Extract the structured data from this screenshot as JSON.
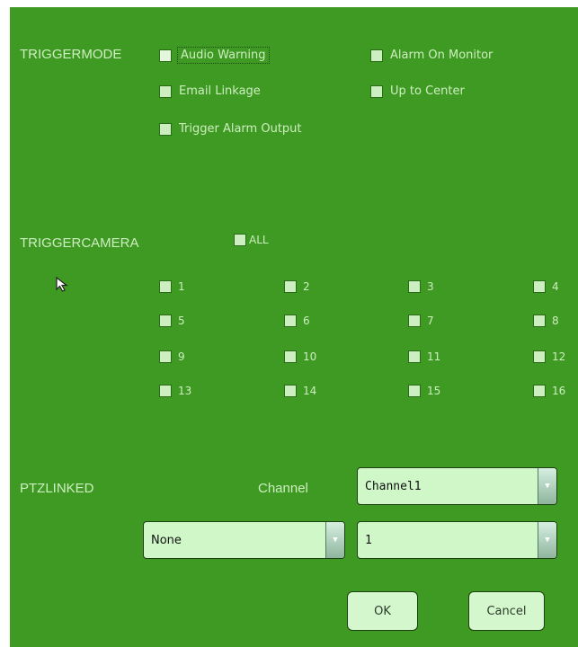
{
  "trigger_mode": {
    "label": "TRIGGERMODE",
    "options": [
      "Audio Warning",
      "Alarm On Monitor",
      "Email Linkage",
      "Up to Center",
      "Trigger Alarm Output"
    ]
  },
  "trigger_camera": {
    "label": "TRIGGERCAMERA",
    "all_label": "ALL",
    "cameras": [
      "1",
      "2",
      "3",
      "4",
      "5",
      "6",
      "7",
      "8",
      "9",
      "10",
      "11",
      "12",
      "13",
      "14",
      "15",
      "16"
    ]
  },
  "ptz": {
    "label": "PTZLINKED",
    "channel_label": "Channel",
    "channel_value": "Channel1",
    "mode_value": "None",
    "preset_value": "1"
  },
  "buttons": {
    "ok": "OK",
    "cancel": "Cancel"
  },
  "colors": {
    "panel": "#3f9a23",
    "text": "#cdeec0",
    "field": "#cff7c8"
  },
  "icons": {
    "cursor": "arrow-cursor-icon",
    "dropdown": "chevron-down-icon"
  }
}
